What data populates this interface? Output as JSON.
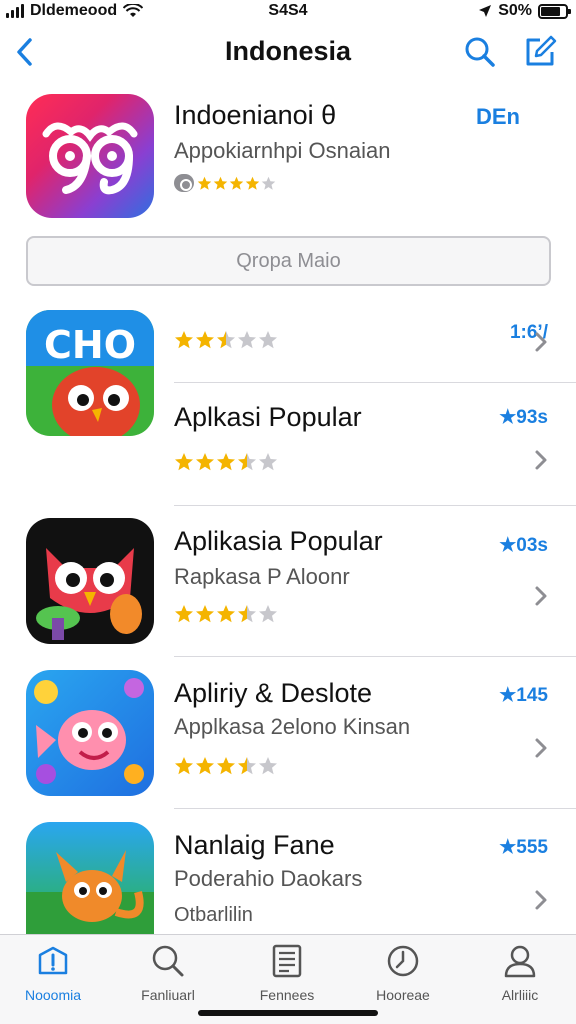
{
  "status": {
    "carrier": "Dldemeood",
    "time": "S4S4",
    "battery": "S0%"
  },
  "nav": {
    "title": "Indonesia",
    "back_icon": "chevron-left-icon",
    "search_icon": "search-icon",
    "compose_icon": "compose-icon"
  },
  "featured": {
    "name": "Indoenianoi θ",
    "subtitle": "Appokiarnhpi Osnaian",
    "action": "DEn",
    "button": "Qropa Maio",
    "stars": 4
  },
  "apps": [
    {
      "name": "",
      "subtitle": "",
      "price": "1:6’/",
      "stars": 2.5
    },
    {
      "name": "Aplkasi Popular",
      "subtitle": "",
      "price": "★93s",
      "stars": 3.5
    },
    {
      "name": "Aplikasia Popular",
      "subtitle": "Rapkasa P Aloonr",
      "price": "★03s",
      "stars": 3.5
    },
    {
      "name": "Apliriy & Deslote",
      "subtitle": "Applkasa 2elono Kinsan",
      "price": "★145",
      "stars": 3.5
    },
    {
      "name": "Nanlaig Fane",
      "subtitle": "Poderahio Daokars",
      "extra": "Otbarlilin",
      "price": "★555",
      "stars": 0
    }
  ],
  "tabs": [
    {
      "label": "Nooomia",
      "icon": "featured-icon",
      "active": true
    },
    {
      "label": "Fanliuarl",
      "icon": "search-icon",
      "active": false
    },
    {
      "label": "Fennees",
      "icon": "list-icon",
      "active": false
    },
    {
      "label": "Hooreae",
      "icon": "updates-icon",
      "active": false
    },
    {
      "label": "Alrliiic",
      "icon": "profile-icon",
      "active": false
    }
  ],
  "colors": {
    "accent": "#1a7fe0",
    "star": "#f4b400",
    "star_empty": "#c7c7cc"
  }
}
